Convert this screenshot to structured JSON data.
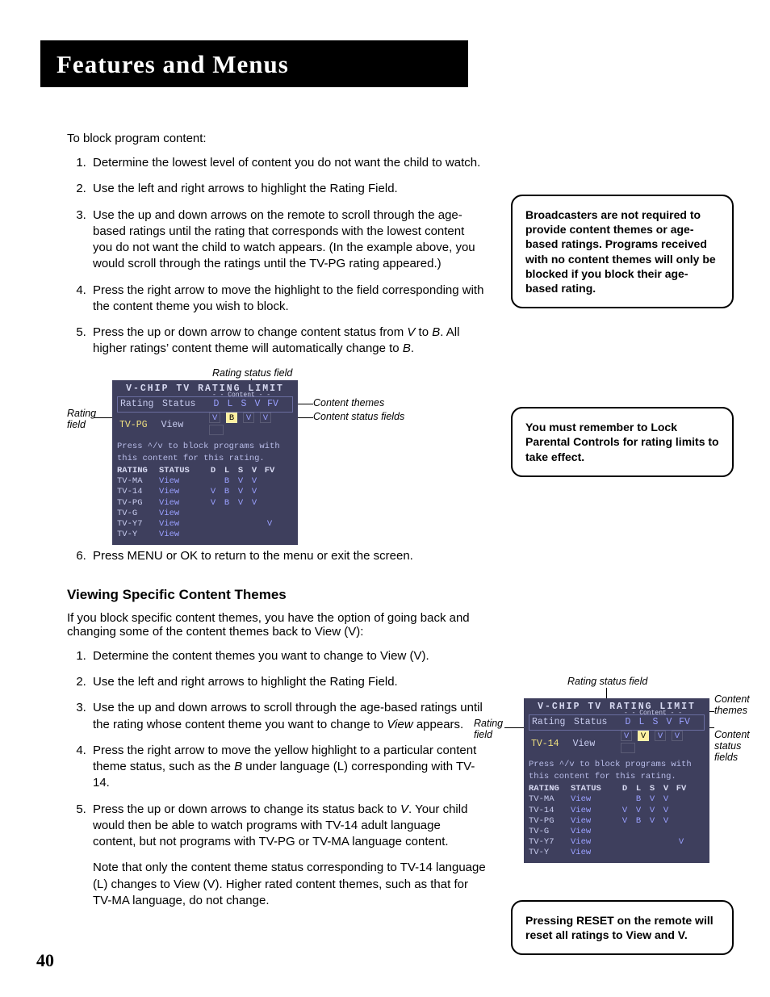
{
  "header": "Features and Menus",
  "page_number": "40",
  "intro": "To block program content:",
  "steps_a": [
    "Determine the lowest level of content you do not want the child to watch.",
    "Use the left and right arrows to highlight the Rating Field.",
    "Use the up and down arrows on the remote to scroll through the age-based ratings until the rating that corresponds with the lowest content you do not want the child to watch appears.  (In the example above, you would scroll through the ratings until the TV-PG rating appeared.)",
    "Press the right arrow to move the highlight to the field corresponding with the content theme you wish to block.",
    "Press the up or down arrow to change content status from V to B. All higher ratings’ content theme will automatically change to B."
  ],
  "step_a6": "Press MENU or OK to return to the menu or exit the screen.",
  "subhead": "Viewing Specific Content Themes",
  "subhead_intro": "If you block specific content themes, you have the option of going back and changing some of the content themes back to View (V):",
  "steps_b": [
    "Determine the content themes you want to change to View (V).",
    "Use the left and right arrows to highlight the Rating Field.",
    "Use the up and down arrows to scroll through the age-based ratings until the rating whose content theme you want to change to View appears.",
    "Press the right arrow to move the yellow highlight to a particular content theme status, such as the B under language (L) corresponding with TV-14.",
    "Press the up or down arrows to change its status back to V.  Your child would then be able to watch programs with TV-14 adult language content, but not programs with  TV-PG or TV-MA language content."
  ],
  "step_b_note": "Note that only the content theme status corresponding to TV-14 language (L) changes to View (V). Higher rated content themes, such as that for TV-MA language, do not change.",
  "side": {
    "box1": "Broadcasters are not required to provide content themes or age-based ratings. Programs received with no content themes will only be blocked if you block their age-based rating.",
    "box2": "You must remember to Lock Parental Controls for rating limits to take effect.",
    "box3": "Pressing RESET on the remote will reset all ratings to View and V."
  },
  "diagram_labels": {
    "rating_status_field": "Rating status field",
    "rating_field": "Rating field",
    "content_themes": "Content themes",
    "content_status_fields": "Content status fields"
  },
  "tv1": {
    "title": "V-CHIP  TV  RATING  LIMIT",
    "header": {
      "rating": "Rating",
      "status": "Status"
    },
    "flag_labels": [
      "D",
      "L",
      "S",
      "V",
      "FV"
    ],
    "content_mini": "- - Content - -",
    "top_row": {
      "rating": "TV-PG",
      "status": "View",
      "flags": [
        "V",
        "B",
        "V",
        "V",
        ""
      ],
      "selected_col": 1
    },
    "note_line1": "Press ^/v to block programs with",
    "note_line2": "this content for this rating.",
    "body_header": {
      "rating": "RATING",
      "status": "STATUS"
    },
    "rows": [
      {
        "rating": "TV-MA",
        "status": "View",
        "flags": [
          "",
          "B",
          "V",
          "V",
          ""
        ]
      },
      {
        "rating": "TV-14",
        "status": "View",
        "flags": [
          "V",
          "B",
          "V",
          "V",
          ""
        ]
      },
      {
        "rating": "TV-PG",
        "status": "View",
        "flags": [
          "V",
          "B",
          "V",
          "V",
          ""
        ]
      },
      {
        "rating": "TV-G",
        "status": "View",
        "flags": [
          "",
          "",
          "",
          "",
          ""
        ]
      },
      {
        "rating": "TV-Y7",
        "status": "View",
        "flags": [
          "",
          "",
          "",
          "",
          "V"
        ]
      },
      {
        "rating": "TV-Y",
        "status": "View",
        "flags": [
          "",
          "",
          "",
          "",
          ""
        ]
      }
    ]
  },
  "tv2": {
    "title": "V-CHIP  TV  RATING  LIMIT",
    "header": {
      "rating": "Rating",
      "status": "Status"
    },
    "flag_labels": [
      "D",
      "L",
      "S",
      "V",
      "FV"
    ],
    "content_mini": "- - Content - -",
    "top_row": {
      "rating": "TV-14",
      "status": "View",
      "flags": [
        "V",
        "V",
        "V",
        "V",
        ""
      ],
      "selected_col": 1
    },
    "note_line1": "Press ^/v to block programs with",
    "note_line2": "this content for this rating.",
    "body_header": {
      "rating": "RATING",
      "status": "STATUS"
    },
    "rows": [
      {
        "rating": "TV-MA",
        "status": "View",
        "flags": [
          "",
          "B",
          "V",
          "V",
          ""
        ]
      },
      {
        "rating": "TV-14",
        "status": "View",
        "flags": [
          "V",
          "V",
          "V",
          "V",
          ""
        ]
      },
      {
        "rating": "TV-PG",
        "status": "View",
        "flags": [
          "V",
          "B",
          "V",
          "V",
          ""
        ]
      },
      {
        "rating": "TV-G",
        "status": "View",
        "flags": [
          "",
          "",
          "",
          "",
          ""
        ]
      },
      {
        "rating": "TV-Y7",
        "status": "View",
        "flags": [
          "",
          "",
          "",
          "",
          "V"
        ]
      },
      {
        "rating": "TV-Y",
        "status": "View",
        "flags": [
          "",
          "",
          "",
          "",
          ""
        ]
      }
    ]
  }
}
